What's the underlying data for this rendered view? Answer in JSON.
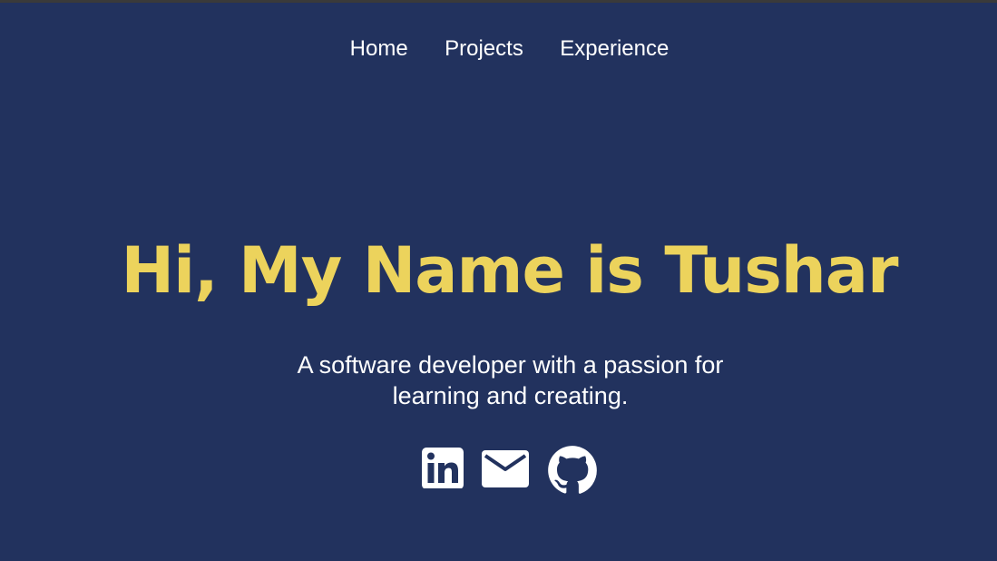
{
  "nav": {
    "items": [
      {
        "label": "Home"
      },
      {
        "label": "Projects"
      },
      {
        "label": "Experience"
      }
    ]
  },
  "hero": {
    "title": "Hi, My Name is Tushar",
    "subtitle": "A software developer with a passion for learning and creating."
  },
  "socials": {
    "items": [
      {
        "icon": "linkedin-icon"
      },
      {
        "icon": "mail-icon"
      },
      {
        "icon": "github-icon"
      }
    ]
  },
  "colors": {
    "background": "#22325e",
    "accent": "#ecd35c",
    "text": "#ffffff"
  }
}
